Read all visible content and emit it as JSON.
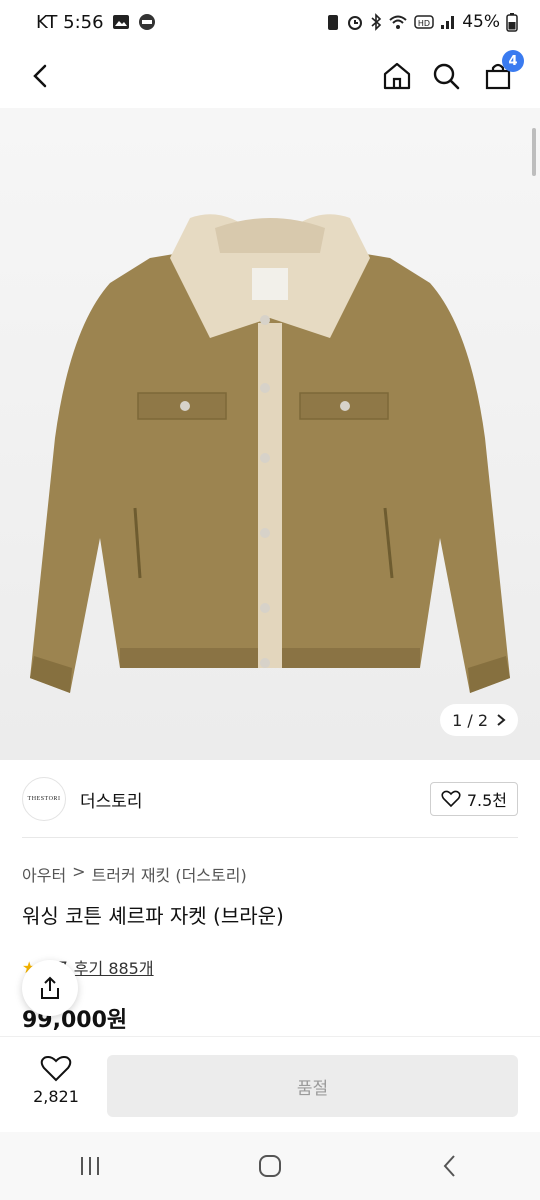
{
  "status_bar": {
    "carrier_time": "KT 5:56",
    "battery": "45%"
  },
  "header": {
    "cart_count": "4",
    "icons": [
      "back-arrow-icon",
      "home-icon",
      "search-icon",
      "shopping-bag-icon"
    ]
  },
  "gallery": {
    "counter": "1 / 2"
  },
  "brand": {
    "logo_text": "THESTORI",
    "name": "더스토리",
    "likes": "7.5천"
  },
  "product": {
    "breadcrumb": [
      "아우터",
      ">",
      "트러커 재킷 (더스토리)"
    ],
    "title": "워싱 코튼 셰르파 자켓 (브라운)",
    "rating": "4.7",
    "reviews": "후기 885개",
    "price": "99,000원"
  },
  "bottom_bar": {
    "wish_count": "2,821",
    "buy_label": "품절"
  },
  "colors": {
    "accent": "#3a7bf0",
    "jacket": "#9c8450"
  }
}
